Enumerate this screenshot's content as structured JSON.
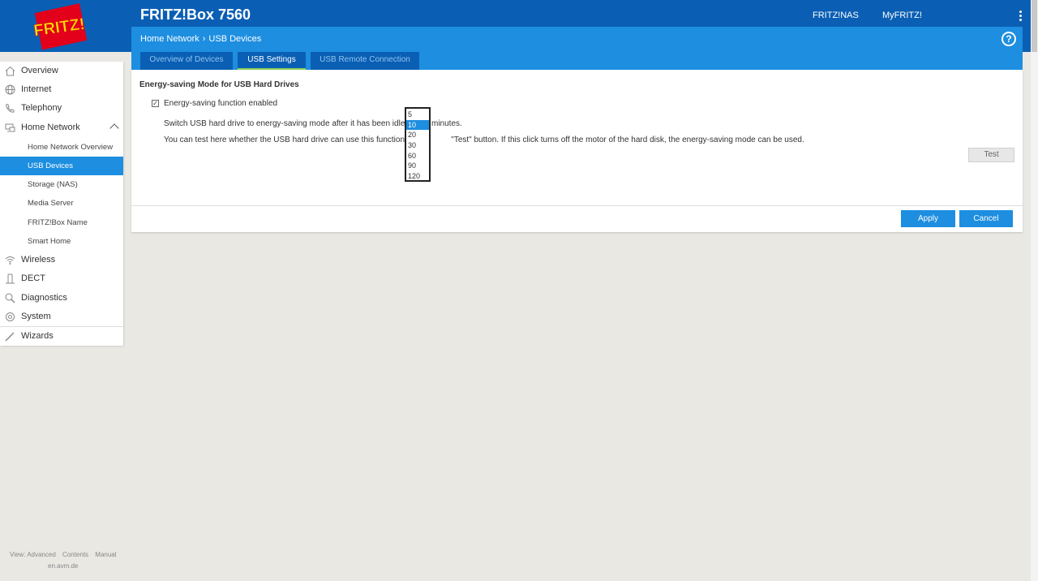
{
  "header": {
    "title": "FRITZ!Box 7560",
    "logo_text": "FRITZ!",
    "links": [
      "FRITZ!NAS",
      "MyFRITZ!"
    ]
  },
  "breadcrumb": {
    "parent": "Home Network",
    "separator": ">",
    "current": "USB Devices"
  },
  "help_label": "?",
  "tabs": [
    {
      "label": "Overview of Devices",
      "active": false
    },
    {
      "label": "USB Settings",
      "active": true
    },
    {
      "label": "USB Remote Connection",
      "active": false
    }
  ],
  "content": {
    "section_title": "Energy-saving Mode for USB Hard Drives",
    "checkbox_label": "Energy-saving function enabled",
    "checkbox_checked": true,
    "idle_text_before": "Switch USB hard drive to energy-saving mode after it has been idle for",
    "idle_text_after": "minutes.",
    "test_text": "You can test here whether the USB hard drive can use this function. Click the \"Test\" button. If this click turns off the motor of the hard disk, the energy-saving mode can be used.",
    "test_text_visible_a": "You can test here whether the USB hard drive can use this function. Cli",
    "test_text_visible_b": "\"Test\" button. If this click turns off the motor of the hard disk, the energy-saving mode can be used.",
    "test_button": "Test",
    "apply_button": "Apply",
    "cancel_button": "Cancel"
  },
  "dropdown": {
    "options": [
      "5",
      "10",
      "20",
      "30",
      "60",
      "90",
      "120"
    ],
    "selected": "10"
  },
  "sidebar": {
    "items": [
      {
        "label": "Overview",
        "icon": "home-icon"
      },
      {
        "label": "Internet",
        "icon": "globe-icon"
      },
      {
        "label": "Telephony",
        "icon": "phone-icon"
      },
      {
        "label": "Home Network",
        "icon": "network-icon",
        "expanded": true
      },
      {
        "label": "Wireless",
        "icon": "wifi-icon"
      },
      {
        "label": "DECT",
        "icon": "dect-icon"
      },
      {
        "label": "Diagnostics",
        "icon": "diagnostics-icon"
      },
      {
        "label": "System",
        "icon": "system-icon"
      },
      {
        "label": "Wizards",
        "icon": "wizard-icon"
      }
    ],
    "subitems": [
      {
        "label": "Home Network Overview",
        "active": false
      },
      {
        "label": "USB Devices",
        "active": true
      },
      {
        "label": "Storage (NAS)",
        "active": false
      },
      {
        "label": "Media Server",
        "active": false
      },
      {
        "label": "FRITZ!Box Name",
        "active": false
      },
      {
        "label": "Smart Home",
        "active": false
      }
    ]
  },
  "footer": {
    "view": "View: Advanced",
    "contents": "Contents",
    "manual": "Manual",
    "site": "en.avm.de"
  },
  "colors": {
    "brand_blue": "#0a5fb4",
    "accent_blue": "#1d8ee0",
    "tab_active_underline": "#8fd05a",
    "page_bg": "#eae8e3"
  }
}
